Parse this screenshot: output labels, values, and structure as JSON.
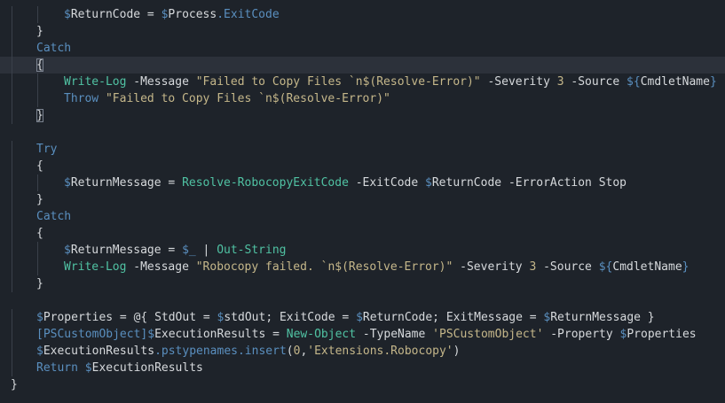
{
  "editor": {
    "language": "powershell",
    "current_line_index": 3,
    "colors": {
      "background": "#1e232a",
      "current_line": "#2c313a",
      "variable": "#d6d9dc",
      "keyword": "#5a8fbf",
      "cmdlet": "#50c2a3",
      "string": "#c5b78a"
    },
    "lines": [
      {
        "indent": 2,
        "tokens": [
          {
            "t": "sig",
            "v": "$"
          },
          {
            "t": "var",
            "v": "ReturnCode"
          },
          {
            "t": "op",
            "v": " = "
          },
          {
            "t": "sig",
            "v": "$"
          },
          {
            "t": "var",
            "v": "Process"
          },
          {
            "t": "prop",
            "v": ".ExitCode"
          }
        ]
      },
      {
        "indent": 1,
        "tokens": [
          {
            "t": "plain",
            "v": "}"
          }
        ]
      },
      {
        "indent": 1,
        "tokens": [
          {
            "t": "kw",
            "v": "Catch"
          }
        ]
      },
      {
        "indent": 1,
        "tokens": [
          {
            "t": "plain",
            "v": "{",
            "match": true
          }
        ]
      },
      {
        "indent": 2,
        "tokens": [
          {
            "t": "cmd",
            "v": "Write-Log"
          },
          {
            "t": "op",
            "v": " "
          },
          {
            "t": "var",
            "v": "-Message"
          },
          {
            "t": "op",
            "v": " "
          },
          {
            "t": "str",
            "v": "\"Failed to Copy Files `n$(Resolve-Error)\""
          },
          {
            "t": "op",
            "v": " "
          },
          {
            "t": "var",
            "v": "-Severity"
          },
          {
            "t": "op",
            "v": " "
          },
          {
            "t": "num",
            "v": "3"
          },
          {
            "t": "op",
            "v": " "
          },
          {
            "t": "var",
            "v": "-Source"
          },
          {
            "t": "op",
            "v": " "
          },
          {
            "t": "sig",
            "v": "${"
          },
          {
            "t": "var",
            "v": "CmdletName"
          },
          {
            "t": "sig",
            "v": "}"
          }
        ]
      },
      {
        "indent": 2,
        "tokens": [
          {
            "t": "kw",
            "v": "Throw"
          },
          {
            "t": "op",
            "v": " "
          },
          {
            "t": "str",
            "v": "\"Failed to Copy Files `n$(Resolve-Error)\""
          }
        ]
      },
      {
        "indent": 1,
        "tokens": [
          {
            "t": "plain",
            "v": "}",
            "match": true
          }
        ]
      },
      {
        "indent": 0,
        "tokens": []
      },
      {
        "indent": 1,
        "tokens": [
          {
            "t": "kw",
            "v": "Try"
          }
        ]
      },
      {
        "indent": 1,
        "tokens": [
          {
            "t": "plain",
            "v": "{"
          }
        ]
      },
      {
        "indent": 2,
        "tokens": [
          {
            "t": "sig",
            "v": "$"
          },
          {
            "t": "var",
            "v": "ReturnMessage"
          },
          {
            "t": "op",
            "v": " = "
          },
          {
            "t": "cmd",
            "v": "Resolve-RobocopyExitCode"
          },
          {
            "t": "op",
            "v": " "
          },
          {
            "t": "var",
            "v": "-ExitCode"
          },
          {
            "t": "op",
            "v": " "
          },
          {
            "t": "sig",
            "v": "$"
          },
          {
            "t": "var",
            "v": "ReturnCode"
          },
          {
            "t": "op",
            "v": " "
          },
          {
            "t": "var",
            "v": "-ErrorAction Stop"
          }
        ]
      },
      {
        "indent": 1,
        "tokens": [
          {
            "t": "plain",
            "v": "}"
          }
        ]
      },
      {
        "indent": 1,
        "tokens": [
          {
            "t": "kw",
            "v": "Catch"
          }
        ]
      },
      {
        "indent": 1,
        "tokens": [
          {
            "t": "plain",
            "v": "{"
          }
        ]
      },
      {
        "indent": 2,
        "tokens": [
          {
            "t": "sig",
            "v": "$"
          },
          {
            "t": "var",
            "v": "ReturnMessage"
          },
          {
            "t": "op",
            "v": " = "
          },
          {
            "t": "sig",
            "v": "$_"
          },
          {
            "t": "op",
            "v": " | "
          },
          {
            "t": "cmd",
            "v": "Out-String"
          }
        ]
      },
      {
        "indent": 2,
        "tokens": [
          {
            "t": "cmd",
            "v": "Write-Log"
          },
          {
            "t": "op",
            "v": " "
          },
          {
            "t": "var",
            "v": "-Message"
          },
          {
            "t": "op",
            "v": " "
          },
          {
            "t": "str",
            "v": "\"Robocopy failed. `n$(Resolve-Error)\""
          },
          {
            "t": "op",
            "v": " "
          },
          {
            "t": "var",
            "v": "-Severity"
          },
          {
            "t": "op",
            "v": " "
          },
          {
            "t": "num",
            "v": "3"
          },
          {
            "t": "op",
            "v": " "
          },
          {
            "t": "var",
            "v": "-Source"
          },
          {
            "t": "op",
            "v": " "
          },
          {
            "t": "sig",
            "v": "${"
          },
          {
            "t": "var",
            "v": "CmdletName"
          },
          {
            "t": "sig",
            "v": "}"
          }
        ]
      },
      {
        "indent": 1,
        "tokens": [
          {
            "t": "plain",
            "v": "}"
          }
        ]
      },
      {
        "indent": 0,
        "tokens": []
      },
      {
        "indent": 1,
        "tokens": [
          {
            "t": "sig",
            "v": "$"
          },
          {
            "t": "var",
            "v": "Properties"
          },
          {
            "t": "op",
            "v": " = @{ StdOut = "
          },
          {
            "t": "sig",
            "v": "$"
          },
          {
            "t": "var",
            "v": "stdOut"
          },
          {
            "t": "op",
            "v": "; ExitCode = "
          },
          {
            "t": "sig",
            "v": "$"
          },
          {
            "t": "var",
            "v": "ReturnCode"
          },
          {
            "t": "op",
            "v": "; ExitMessage = "
          },
          {
            "t": "sig",
            "v": "$"
          },
          {
            "t": "var",
            "v": "ReturnMessage"
          },
          {
            "t": "op",
            "v": " }"
          }
        ]
      },
      {
        "indent": 1,
        "tokens": [
          {
            "t": "type",
            "v": "[PSCustomObject]"
          },
          {
            "t": "sig",
            "v": "$"
          },
          {
            "t": "var",
            "v": "ExecutionResults"
          },
          {
            "t": "op",
            "v": " = "
          },
          {
            "t": "cmd",
            "v": "New-Object"
          },
          {
            "t": "op",
            "v": " "
          },
          {
            "t": "var",
            "v": "-TypeName"
          },
          {
            "t": "op",
            "v": " "
          },
          {
            "t": "str",
            "v": "'PSCustomObject'"
          },
          {
            "t": "op",
            "v": " "
          },
          {
            "t": "var",
            "v": "-Property"
          },
          {
            "t": "op",
            "v": " "
          },
          {
            "t": "sig",
            "v": "$"
          },
          {
            "t": "var",
            "v": "Properties"
          }
        ]
      },
      {
        "indent": 1,
        "tokens": [
          {
            "t": "sig",
            "v": "$"
          },
          {
            "t": "var",
            "v": "ExecutionResults"
          },
          {
            "t": "prop",
            "v": ".pstypenames.insert"
          },
          {
            "t": "op",
            "v": "("
          },
          {
            "t": "num",
            "v": "0"
          },
          {
            "t": "op",
            "v": ","
          },
          {
            "t": "str",
            "v": "'Extensions.Robocopy'"
          },
          {
            "t": "op",
            "v": ")"
          }
        ]
      },
      {
        "indent": 1,
        "tokens": [
          {
            "t": "kw",
            "v": "Return"
          },
          {
            "t": "op",
            "v": " "
          },
          {
            "t": "sig",
            "v": "$"
          },
          {
            "t": "var",
            "v": "ExecutionResults"
          }
        ]
      },
      {
        "indent": 0,
        "tokens": [
          {
            "t": "plain",
            "v": "}"
          }
        ]
      }
    ]
  }
}
